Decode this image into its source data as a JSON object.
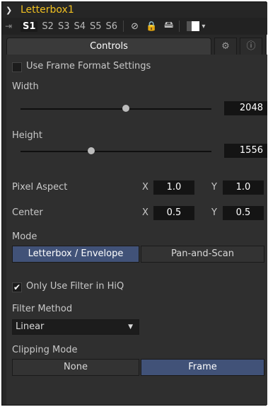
{
  "header": {
    "title": "Letterbox1"
  },
  "versions": {
    "slots": [
      "S1",
      "S2",
      "S3",
      "S4",
      "S5",
      "S6"
    ],
    "active": "S1"
  },
  "tabs": {
    "controls_label": "Controls"
  },
  "use_frame_format": {
    "label": "Use Frame Format Settings",
    "checked": false
  },
  "width": {
    "label": "Width",
    "value": "2048",
    "level": 0.55
  },
  "height": {
    "label": "Height",
    "value": "1556",
    "level": 0.37
  },
  "pixel_aspect": {
    "label": "Pixel Aspect",
    "x_axis": "X",
    "x": "1.0",
    "y_axis": "Y",
    "y": "1.0"
  },
  "center": {
    "label": "Center",
    "x_axis": "X",
    "x": "0.5",
    "y_axis": "Y",
    "y": "0.5"
  },
  "mode": {
    "label": "Mode",
    "options": [
      "Letterbox / Envelope",
      "Pan-and-Scan"
    ],
    "selected": "Letterbox / Envelope"
  },
  "hiq": {
    "label": "Only Use Filter in HiQ",
    "checked": true
  },
  "filter_method": {
    "label": "Filter Method",
    "value": "Linear"
  },
  "clipping_mode": {
    "label": "Clipping Mode",
    "options": [
      "None",
      "Frame"
    ],
    "selected": "Frame"
  }
}
